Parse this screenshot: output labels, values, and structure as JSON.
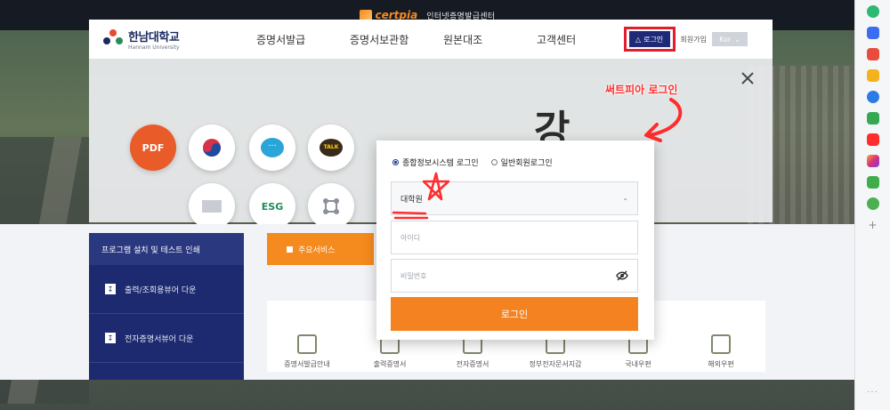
{
  "browser": {
    "logo_text": "certpia",
    "title": "인터넷증명발급센터"
  },
  "header": {
    "brand_ko": "한남대학교",
    "brand_en": "Hannam University",
    "brand_mark": "HAN NAM",
    "nav": [
      "증명서발급",
      "증명서보관함",
      "원본대조",
      "고객센터"
    ],
    "login_label": "로그인",
    "join_label": "회원가입",
    "lang_label": "Kor"
  },
  "annotation": {
    "text": "써트피아 로그인"
  },
  "background_panel": {
    "icons": [
      {
        "label": "PDF",
        "icon": "pdf-icon"
      },
      {
        "label": "",
        "icon": "gov-icon"
      },
      {
        "label": "",
        "icon": "chat-icon"
      },
      {
        "label": "TALK",
        "icon": "kakaotalk-icon"
      },
      {
        "label": "",
        "icon": "mail-icon"
      },
      {
        "label": "ESG",
        "icon": "esg-icon"
      },
      {
        "label": "",
        "icon": "network-icon"
      }
    ]
  },
  "left_panel": {
    "header": "프로그램 설치 및 테스트 인쇄",
    "downloads": [
      "출력/조회용뷰어 다운",
      "전자증명서뷰어 다운"
    ]
  },
  "services": {
    "tab_label": "주요서비스",
    "items": [
      "증명서발급안내",
      "출력증명서",
      "전자증명서",
      "정부전자문서지갑",
      "국내우편",
      "해외우편"
    ]
  },
  "login_modal": {
    "radio_integrated": "종합정보시스템 로그인",
    "radio_general": "일반회원로그인",
    "selected_radio": "integrated",
    "select_value": "대학원",
    "id_placeholder": "아이디",
    "pw_placeholder": "비밀번호",
    "submit_label": "로그인"
  },
  "colors": {
    "primary_navy": "#1e2a78",
    "accent_orange": "#f58220",
    "annotation_red": "#e11d2e"
  }
}
